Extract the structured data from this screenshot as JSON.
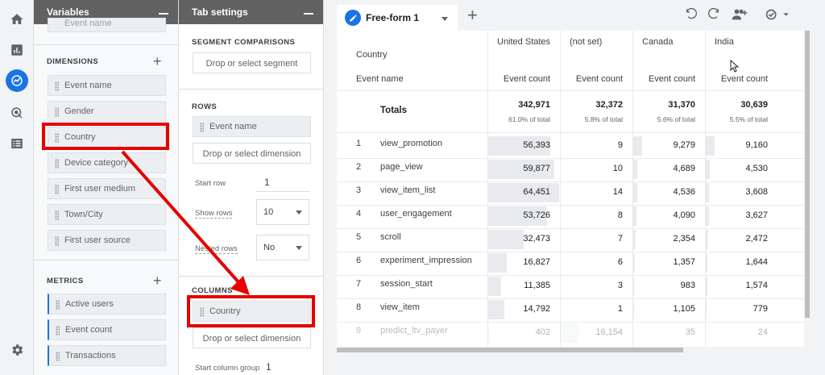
{
  "variables_panel": {
    "title": "Variables",
    "cut_item": "Event name",
    "dimensions_label": "DIMENSIONS",
    "dimensions": [
      "Event name",
      "Gender",
      "Country",
      "Device category",
      "First user medium",
      "Town/City",
      "First user source"
    ],
    "metrics_label": "METRICS",
    "metrics": [
      "Active users",
      "Event count",
      "Transactions"
    ]
  },
  "tab_settings": {
    "title": "Tab settings",
    "segment_label": "SEGMENT COMPARISONS",
    "segment_drop": "Drop or select segment",
    "rows_label": "ROWS",
    "rows_item": "Event name",
    "rows_drop": "Drop or select dimension",
    "start_row_label": "Start row",
    "start_row_value": "1",
    "show_rows_label": "Show rows",
    "show_rows_value": "10",
    "nested_rows_label": "Nested rows",
    "nested_rows_value": "No",
    "columns_label": "COLUMNS",
    "columns_item": "Country",
    "columns_drop": "Drop or select dimension",
    "start_col_label": "Start column group",
    "start_col_value": "1"
  },
  "exploration": {
    "tab_label": "Free-form 1",
    "header_dimension": "Country",
    "header_row_dimension": "Event name",
    "columns": [
      "United States",
      "(not set)",
      "Canada",
      "India"
    ],
    "metric_label": "Event count",
    "totals_label": "Totals",
    "totals": [
      "342,971",
      "32,372",
      "31,370",
      "30,639"
    ],
    "totals_pct": [
      "61.0% of total",
      "5.8% of total",
      "5.6% of total",
      "5.5% of total"
    ],
    "rows": [
      {
        "idx": "1",
        "name": "view_promotion",
        "values": [
          "56,393",
          "9",
          "9,279",
          "9,160"
        ]
      },
      {
        "idx": "2",
        "name": "page_view",
        "values": [
          "59,877",
          "10",
          "4,689",
          "4,530"
        ]
      },
      {
        "idx": "3",
        "name": "view_item_list",
        "values": [
          "64,451",
          "14",
          "4,536",
          "3,608"
        ]
      },
      {
        "idx": "4",
        "name": "user_engagement",
        "values": [
          "53,726",
          "8",
          "4,090",
          "3,627"
        ]
      },
      {
        "idx": "5",
        "name": "scroll",
        "values": [
          "32,473",
          "7",
          "2,354",
          "2,472"
        ]
      },
      {
        "idx": "6",
        "name": "experiment_impression",
        "values": [
          "16,827",
          "6",
          "1,357",
          "1,644"
        ]
      },
      {
        "idx": "7",
        "name": "session_start",
        "values": [
          "11,385",
          "3",
          "983",
          "1,574"
        ]
      },
      {
        "idx": "8",
        "name": "view_item",
        "values": [
          "14,792",
          "1",
          "1,105",
          "779"
        ]
      },
      {
        "idx": "9",
        "name": "predict_ltv_payer",
        "values": [
          "402",
          "16,154",
          "35",
          "24"
        ]
      }
    ],
    "bar_fractions": [
      [
        0.87,
        0.0,
        0.12,
        0.12
      ],
      [
        0.93,
        0.0,
        0.06,
        0.06
      ],
      [
        1.0,
        0.0,
        0.06,
        0.05
      ],
      [
        0.83,
        0.0,
        0.05,
        0.05
      ],
      [
        0.5,
        0.0,
        0.03,
        0.03
      ],
      [
        0.26,
        0.0,
        0.02,
        0.02
      ],
      [
        0.18,
        0.0,
        0.01,
        0.02
      ],
      [
        0.23,
        0.0,
        0.01,
        0.01
      ],
      [
        0.01,
        0.25,
        0.0,
        0.0
      ]
    ]
  },
  "colors": {
    "accent": "#1a73e8",
    "highlight": "#e60000",
    "bar_line": "#4285f4"
  }
}
